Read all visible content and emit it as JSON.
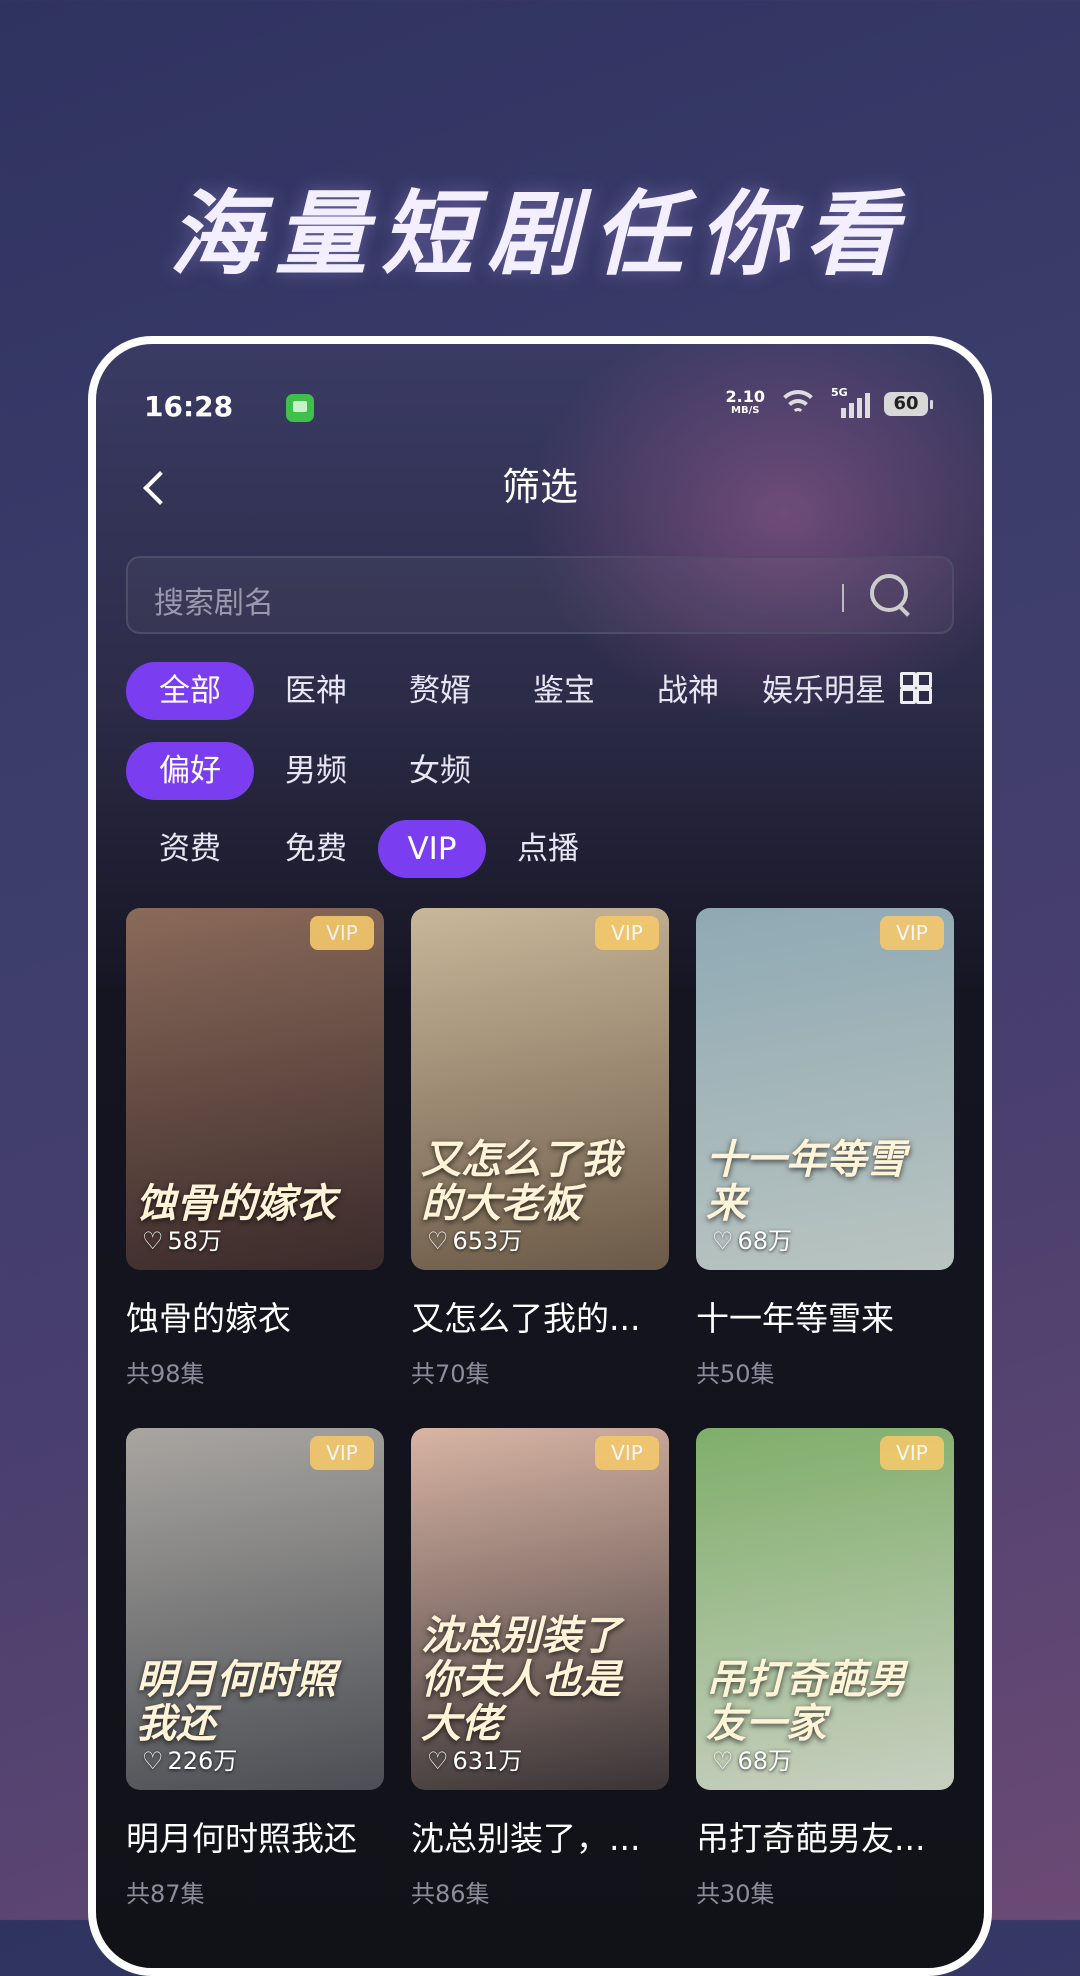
{
  "promo": {
    "title": "海量短剧任你看"
  },
  "status_bar": {
    "time": "16:28",
    "net_speed": "2.10",
    "net_unit": "MB/S",
    "network": "5G",
    "battery": "60"
  },
  "header": {
    "title": "筛选"
  },
  "search": {
    "placeholder": "搜索剧名"
  },
  "filters": {
    "genre": [
      "全部",
      "医神",
      "赘婿",
      "鉴宝",
      "战神",
      "娱乐明星"
    ],
    "preference": [
      "偏好",
      "男频",
      "女频"
    ],
    "payment": [
      "资费",
      "免费",
      "VIP",
      "点播"
    ]
  },
  "badge_label": "VIP",
  "cards": [
    {
      "title": "蚀骨的嫁衣",
      "episodes": "共98集",
      "likes": "58万",
      "poster_text": "蚀骨的嫁衣",
      "colors": [
        "#8a6a5a",
        "#3a2a2a"
      ]
    },
    {
      "title": "又怎么了我的...",
      "episodes": "共70集",
      "likes": "653万",
      "poster_text": "又怎么了我的大老板",
      "colors": [
        "#c9b79a",
        "#6b5a48"
      ]
    },
    {
      "title": "十一年等雪来",
      "episodes": "共50集",
      "likes": "68万",
      "poster_text": "十一年等雪来",
      "colors": [
        "#8fa9b4",
        "#b9c4c0"
      ]
    },
    {
      "title": "明月何时照我还",
      "episodes": "共87集",
      "likes": "226万",
      "poster_text": "明月何时照我还",
      "colors": [
        "#a9a6a1",
        "#4b4e54"
      ]
    },
    {
      "title": "沈总别装了，...",
      "episodes": "共86集",
      "likes": "631万",
      "poster_text": "沈总别装了 你夫人也是大佬",
      "colors": [
        "#d8b4a4",
        "#3a3436"
      ]
    },
    {
      "title": "吊打奇葩男友...",
      "episodes": "共30集",
      "likes": "68万",
      "poster_text": "吊打奇葩男友一家",
      "colors": [
        "#7fae6a",
        "#c7cfc0"
      ]
    }
  ]
}
